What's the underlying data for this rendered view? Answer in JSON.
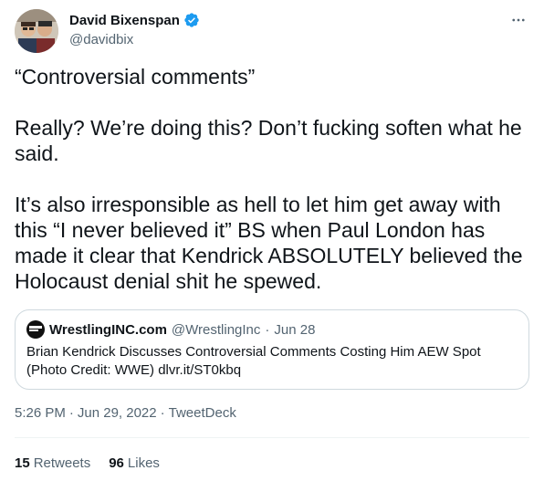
{
  "author": {
    "name": "David Bixenspan",
    "handle": "@davidbix"
  },
  "tweet": {
    "text": "“Controversial comments”\n\nReally? We’re doing this? Don’t fucking soften what he said.\n\nIt’s also irresponsible as hell to let him get away with this “I never believed it” BS when Paul London has made it clear that Kendrick ABSOLUTELY believed the Holocaust denial shit he spewed."
  },
  "quote": {
    "name": "WrestlingINC.com",
    "handle": "@WrestlingInc",
    "separator": "·",
    "date": "Jun 28",
    "text": "Brian Kendrick Discusses Controversial Comments Costing Him AEW Spot (Photo Credit: WWE) dlvr.it/ST0kbq"
  },
  "meta": {
    "time": "5:26 PM",
    "dot1": "·",
    "date": "Jun 29, 2022",
    "dot2": "·",
    "source": "TweetDeck"
  },
  "stats": {
    "retweets_count": "15",
    "retweets_label": "Retweets",
    "likes_count": "96",
    "likes_label": "Likes"
  },
  "colors": {
    "verified": "#1d9bf0",
    "secondary_text": "#536471",
    "border": "#cfd9de"
  },
  "icons": [
    "verified-badge-icon",
    "more-options-icon"
  ]
}
